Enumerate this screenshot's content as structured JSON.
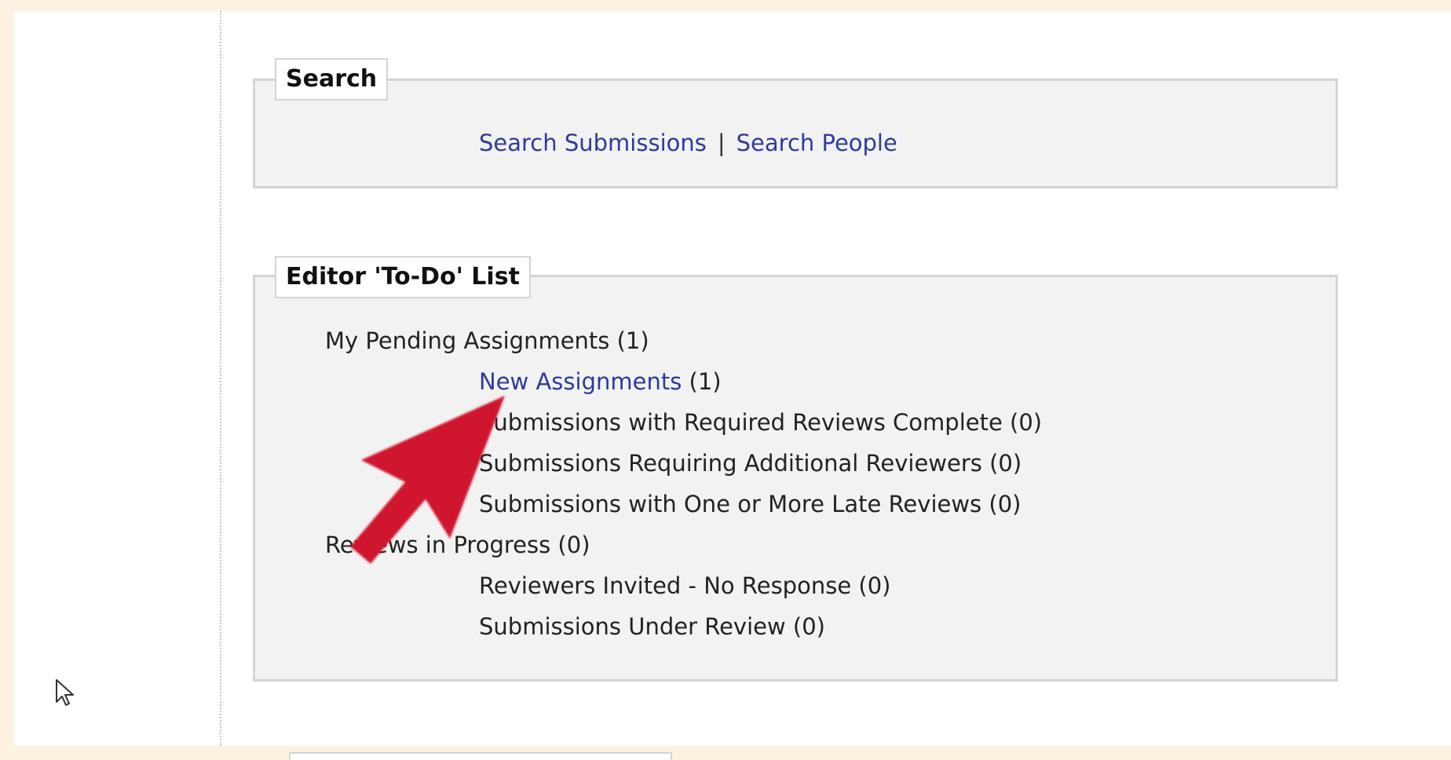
{
  "search": {
    "legend": "Search",
    "search_submissions": "Search Submissions",
    "separator": "|",
    "search_people": "Search People"
  },
  "todo": {
    "legend": "Editor 'To-Do' List",
    "pending": {
      "label": "My Pending Assignments (1)",
      "new_assignments_link": "New Assignments",
      "new_assignments_count": " (1)",
      "items": [
        "Submissions with Required Reviews Complete (0)",
        "Submissions Requiring Additional Reviewers (0)",
        "Submissions with One or More Late Reviews (0)"
      ]
    },
    "reviews": {
      "label": "Reviews in Progress (0)",
      "items": [
        "Reviewers Invited - No Response (0)",
        "Submissions Under Review (0)"
      ]
    }
  },
  "colors": {
    "link": "#2e3b9c",
    "annotation_arrow": "#d0122e",
    "panel_background": "#f2f2f2",
    "page_border": "#fdf1e0"
  },
  "icons": {
    "cursor": "mouse-pointer-icon",
    "annotation": "red-arrow-annotation"
  }
}
